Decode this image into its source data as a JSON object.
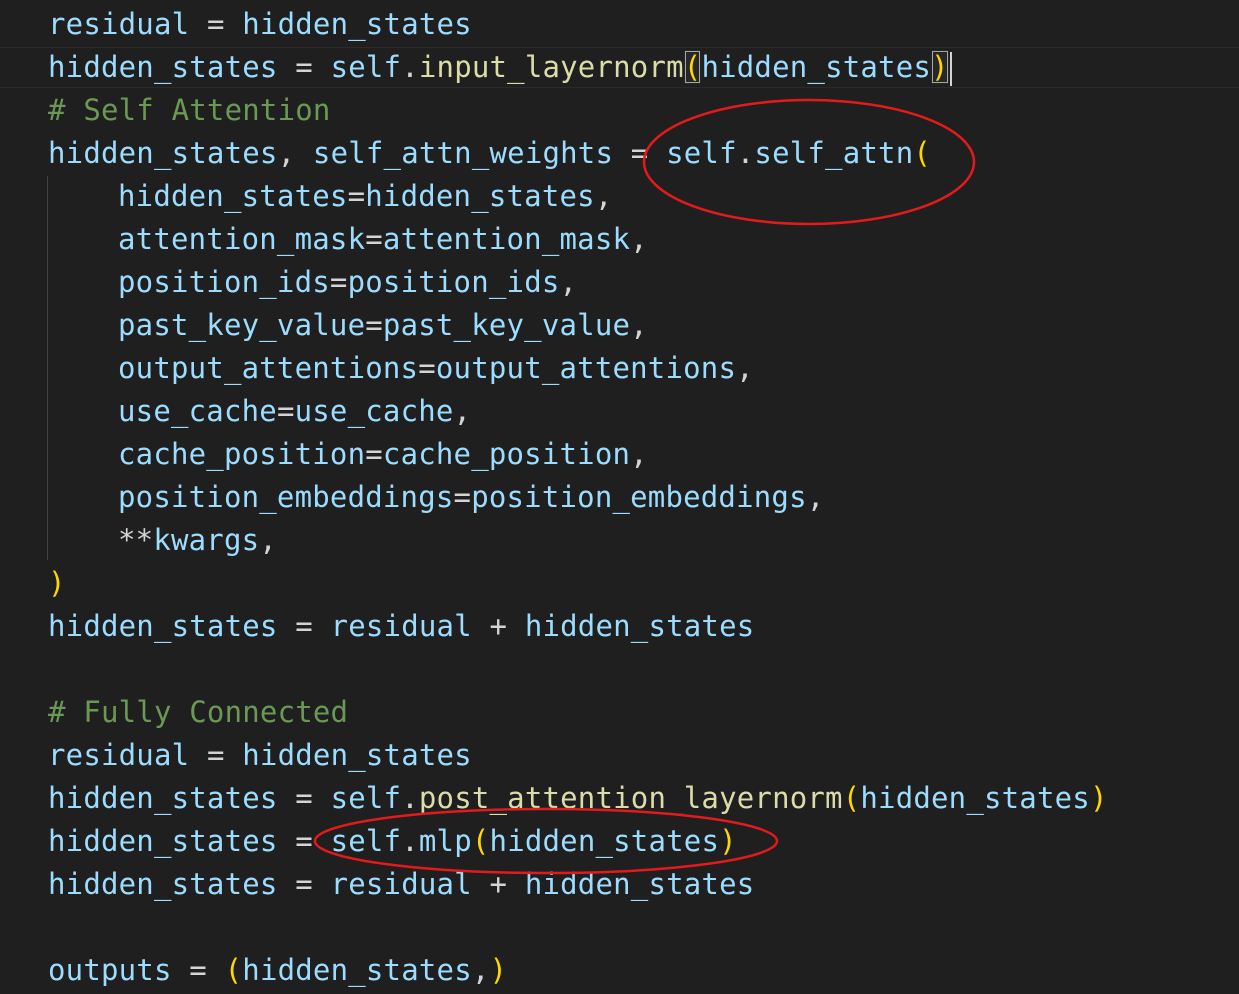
{
  "code": {
    "lines": [
      [
        {
          "t": "residual",
          "k": "v"
        },
        {
          "t": " = ",
          "k": "o"
        },
        {
          "t": "hidden_states",
          "k": "v"
        }
      ],
      [
        {
          "t": "hidden_states",
          "k": "v"
        },
        {
          "t": " = ",
          "k": "o"
        },
        {
          "t": "self",
          "k": "v"
        },
        {
          "t": ".",
          "k": "o"
        },
        {
          "t": "input_layernorm",
          "k": "f"
        },
        {
          "t": "(",
          "k": "bm"
        },
        {
          "t": "hidden_states",
          "k": "v"
        },
        {
          "t": ")",
          "k": "bm"
        }
      ],
      [
        {
          "t": "# Self Attention",
          "k": "c"
        }
      ],
      [
        {
          "t": "hidden_states",
          "k": "v"
        },
        {
          "t": ", ",
          "k": "o"
        },
        {
          "t": "self_attn_weights",
          "k": "v"
        },
        {
          "t": " = ",
          "k": "o"
        },
        {
          "t": "self",
          "k": "v"
        },
        {
          "t": ".",
          "k": "o"
        },
        {
          "t": "self_attn",
          "k": "v"
        },
        {
          "t": "(",
          "k": "b"
        }
      ],
      [
        {
          "t": "hidden_states",
          "k": "v"
        },
        {
          "t": "=",
          "k": "o"
        },
        {
          "t": "hidden_states",
          "k": "v"
        },
        {
          "t": ",",
          "k": "o"
        }
      ],
      [
        {
          "t": "attention_mask",
          "k": "v"
        },
        {
          "t": "=",
          "k": "o"
        },
        {
          "t": "attention_mask",
          "k": "v"
        },
        {
          "t": ",",
          "k": "o"
        }
      ],
      [
        {
          "t": "position_ids",
          "k": "v"
        },
        {
          "t": "=",
          "k": "o"
        },
        {
          "t": "position_ids",
          "k": "v"
        },
        {
          "t": ",",
          "k": "o"
        }
      ],
      [
        {
          "t": "past_key_value",
          "k": "v"
        },
        {
          "t": "=",
          "k": "o"
        },
        {
          "t": "past_key_value",
          "k": "v"
        },
        {
          "t": ",",
          "k": "o"
        }
      ],
      [
        {
          "t": "output_attentions",
          "k": "v"
        },
        {
          "t": "=",
          "k": "o"
        },
        {
          "t": "output_attentions",
          "k": "v"
        },
        {
          "t": ",",
          "k": "o"
        }
      ],
      [
        {
          "t": "use_cache",
          "k": "v"
        },
        {
          "t": "=",
          "k": "o"
        },
        {
          "t": "use_cache",
          "k": "v"
        },
        {
          "t": ",",
          "k": "o"
        }
      ],
      [
        {
          "t": "cache_position",
          "k": "v"
        },
        {
          "t": "=",
          "k": "o"
        },
        {
          "t": "cache_position",
          "k": "v"
        },
        {
          "t": ",",
          "k": "o"
        }
      ],
      [
        {
          "t": "position_embeddings",
          "k": "v"
        },
        {
          "t": "=",
          "k": "o"
        },
        {
          "t": "position_embeddings",
          "k": "v"
        },
        {
          "t": ",",
          "k": "o"
        }
      ],
      [
        {
          "t": "**",
          "k": "o"
        },
        {
          "t": "kwargs",
          "k": "v"
        },
        {
          "t": ",",
          "k": "o"
        }
      ],
      [
        {
          "t": ")",
          "k": "b"
        }
      ],
      [
        {
          "t": "hidden_states",
          "k": "v"
        },
        {
          "t": " = ",
          "k": "o"
        },
        {
          "t": "residual",
          "k": "v"
        },
        {
          "t": " + ",
          "k": "o"
        },
        {
          "t": "hidden_states",
          "k": "v"
        }
      ],
      [],
      [
        {
          "t": "# Fully Connected",
          "k": "c"
        }
      ],
      [
        {
          "t": "residual",
          "k": "v"
        },
        {
          "t": " = ",
          "k": "o"
        },
        {
          "t": "hidden_states",
          "k": "v"
        }
      ],
      [
        {
          "t": "hidden_states",
          "k": "v"
        },
        {
          "t": " = ",
          "k": "o"
        },
        {
          "t": "self",
          "k": "v"
        },
        {
          "t": ".",
          "k": "o"
        },
        {
          "t": "post_attention_layernorm",
          "k": "f"
        },
        {
          "t": "(",
          "k": "b"
        },
        {
          "t": "hidden_states",
          "k": "v"
        },
        {
          "t": ")",
          "k": "b"
        }
      ],
      [
        {
          "t": "hidden_states",
          "k": "v"
        },
        {
          "t": " = ",
          "k": "o"
        },
        {
          "t": "self",
          "k": "v"
        },
        {
          "t": ".",
          "k": "o"
        },
        {
          "t": "mlp",
          "k": "v"
        },
        {
          "t": "(",
          "k": "b"
        },
        {
          "t": "hidden_states",
          "k": "v"
        },
        {
          "t": ")",
          "k": "b"
        }
      ],
      [
        {
          "t": "hidden_states",
          "k": "v"
        },
        {
          "t": " = ",
          "k": "o"
        },
        {
          "t": "residual",
          "k": "v"
        },
        {
          "t": " + ",
          "k": "o"
        },
        {
          "t": "hidden_states",
          "k": "v"
        }
      ],
      [],
      [
        {
          "t": "outputs",
          "k": "v"
        },
        {
          "t": " = ",
          "k": "o"
        },
        {
          "t": "(",
          "k": "b"
        },
        {
          "t": "hidden_states",
          "k": "v"
        },
        {
          "t": ",",
          "k": "o"
        },
        {
          "t": ")",
          "k": "b"
        }
      ]
    ],
    "indented_lines": [
      4,
      5,
      6,
      7,
      8,
      9,
      10,
      11,
      12
    ],
    "cursor_line": 1
  },
  "annotations": {
    "ellipse_color": "#e31a1c"
  },
  "theme": {
    "background": "#1f1f1f",
    "variable": "#9cdcfe",
    "function": "#dcdcaa",
    "operator": "#d4d4d4",
    "comment": "#6a9955",
    "bracket": "#ffd700"
  }
}
